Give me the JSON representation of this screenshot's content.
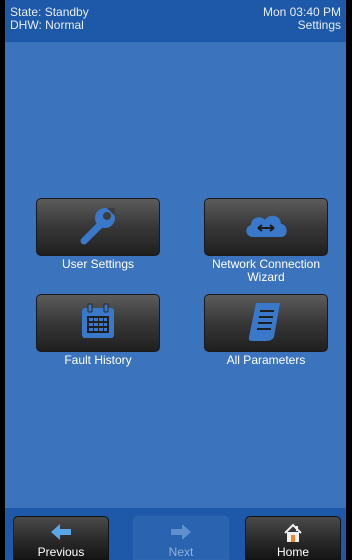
{
  "header": {
    "state": "State: Standby",
    "dhw": "DHW: Normal",
    "datetime": "Mon 03:40 PM",
    "screen_title": "Settings"
  },
  "tiles": [
    {
      "label": "User Settings",
      "icon": "wrench-icon"
    },
    {
      "label": "Network Connection Wizard",
      "icon": "cloud-icon"
    },
    {
      "label": "Fault History",
      "icon": "calendar-icon"
    },
    {
      "label": "All Parameters",
      "icon": "document-icon"
    }
  ],
  "footer": {
    "previous": "Previous",
    "next": "Next",
    "home": "Home"
  },
  "colors": {
    "background": "#3b73bd",
    "header_bar": "#1e58a8",
    "button_dark": "#2f2f2f",
    "icon_blue": "#3a78c9"
  }
}
